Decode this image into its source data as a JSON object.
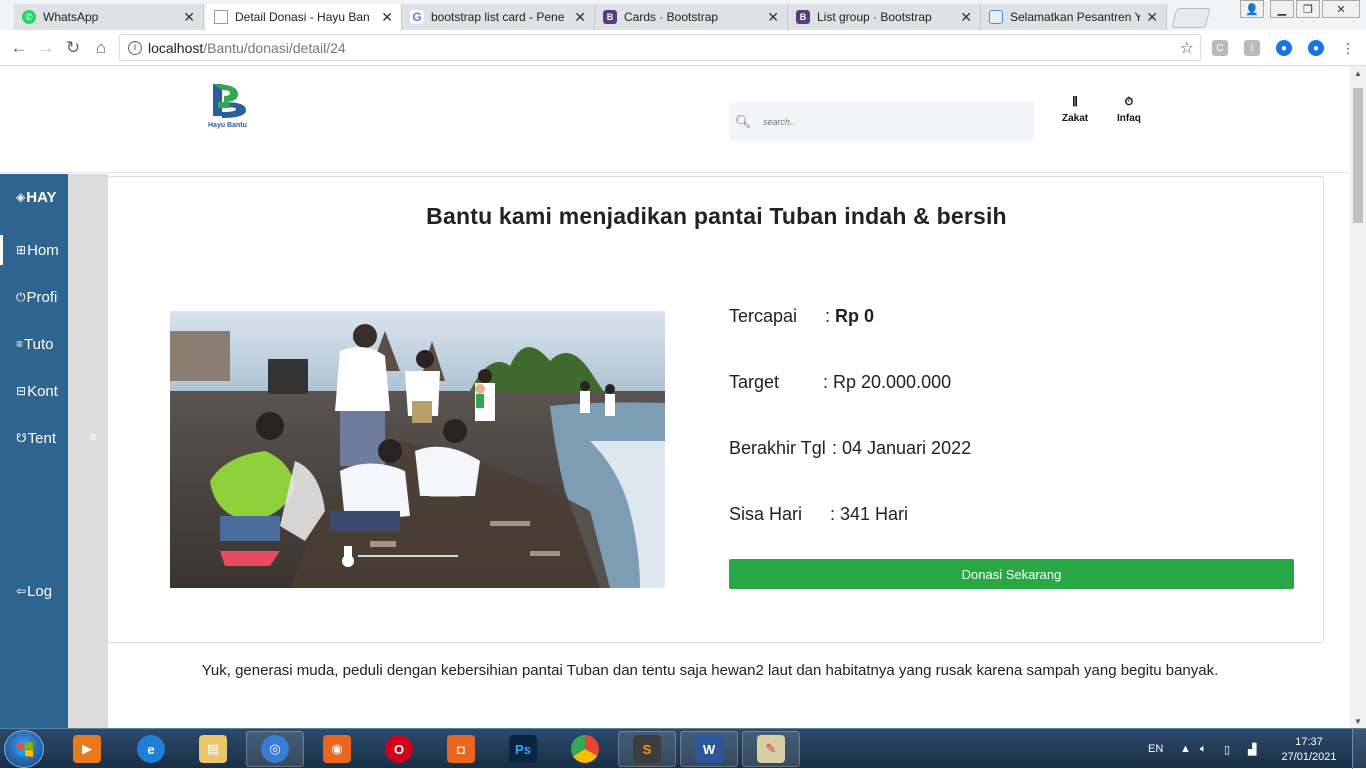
{
  "browser": {
    "tabs": [
      {
        "title": "WhatsApp",
        "icon": "whatsapp-icon",
        "color": "#25d366"
      },
      {
        "title": "Detail Donasi - Hayu Ban",
        "icon": "page-icon",
        "color": "#9e9e9e"
      },
      {
        "title": "bootstrap list card - Pene",
        "icon": "google-icon",
        "color": "#4285f4"
      },
      {
        "title": "Cards · Bootstrap",
        "icon": "bootstrap-icon",
        "color": "#563d7c"
      },
      {
        "title": "List group · Bootstrap",
        "icon": "bootstrap-icon",
        "color": "#563d7c"
      },
      {
        "title": "Selamatkan Pesantren Ya",
        "icon": "site-icon",
        "color": "#4a90d9"
      }
    ],
    "url_host": "localhost",
    "url_path": "/Bantu/donasi/detail/24"
  },
  "site": {
    "logo_text": "Hayu Bantu",
    "search_placeholder": "search..",
    "nav": [
      {
        "label": "Zakat",
        "icon": "chart-icon"
      },
      {
        "label": "Infaq",
        "icon": "timer-icon"
      }
    ]
  },
  "sidebar": {
    "brand": "HAY",
    "items": [
      {
        "label": "Hom",
        "icon": "grid-icon"
      },
      {
        "label": "Profi",
        "icon": "power-icon"
      },
      {
        "label": "Tuto",
        "icon": "list-icon"
      },
      {
        "label": "Kont",
        "icon": "contact-icon"
      },
      {
        "label": "Tent",
        "icon": "about-icon"
      }
    ],
    "logout": "Log"
  },
  "detail": {
    "title": "Bantu kami menjadikan pantai Tuban indah & bersih",
    "tercapai_label": "Tercapai",
    "tercapai_value": "Rp 0",
    "target_label": "Target",
    "target_value": ": Rp 20.000.000",
    "berakhir_label": "Berakhir Tgl",
    "berakhir_value": ": 04 Januari 2022",
    "sisa_label": "Sisa Hari",
    "sisa_value": ": 341 Hari",
    "donate_button": "Donasi Sekarang",
    "description": "Yuk, generasi muda, peduli dengan kebersihian pantai Tuban dan tentu saja hewan2 laut dan habitatnya yang rusak karena sampah yang begitu banyak."
  },
  "taskbar": {
    "lang": "EN",
    "time": "17:37",
    "date": "27/01/2021"
  }
}
